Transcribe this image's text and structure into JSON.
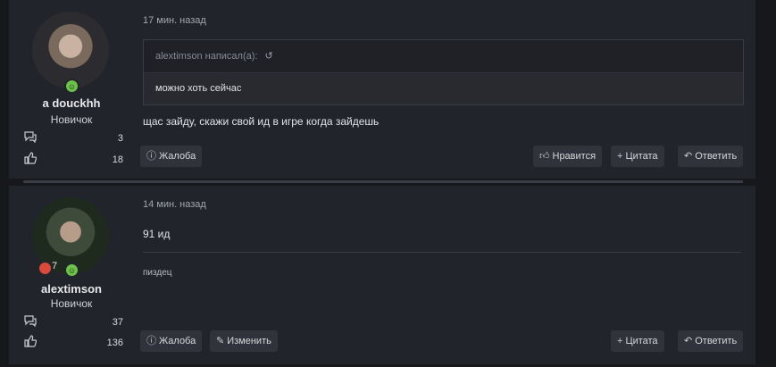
{
  "posts": [
    {
      "username": "a douckhh",
      "user_title": "Новичок",
      "messages_count": "3",
      "likes_count": "18",
      "time": "17 мин. назад",
      "quote": {
        "author_line": "alextimson написал(а):",
        "text": "можно хоть сейчас"
      },
      "text": "щас зайду, скажи свой ид в игре когда зайдешь",
      "buttons": {
        "report": "Жалоба",
        "like": "Нравится",
        "quote": "Цитата",
        "reply": "Ответить"
      }
    },
    {
      "username": "alextimson",
      "user_title": "Новичок",
      "rank_number": "7",
      "messages_count": "37",
      "likes_count": "136",
      "time": "14 мин. назад",
      "text": "91 ид",
      "signature": "пиздец",
      "buttons": {
        "report": "Жалоба",
        "edit": "Изменить",
        "quote": "Цитата",
        "reply": "Ответить"
      }
    }
  ],
  "icons": {
    "messages": "speech-bubbles-icon",
    "likes": "thumbs-up-icon",
    "online": "online-status-icon",
    "report": "report-icon",
    "like": "thumbs-up-icon",
    "quote": "plus-icon",
    "reply": "reply-icon",
    "edit": "pencil-icon",
    "quote_jump": "quote-jump-icon"
  },
  "colors": {
    "background": "#17181c",
    "post_background": "#22242b",
    "button_background": "#30333b",
    "online_status": "#6cc24a",
    "rank_badge": "#d94a3a"
  }
}
